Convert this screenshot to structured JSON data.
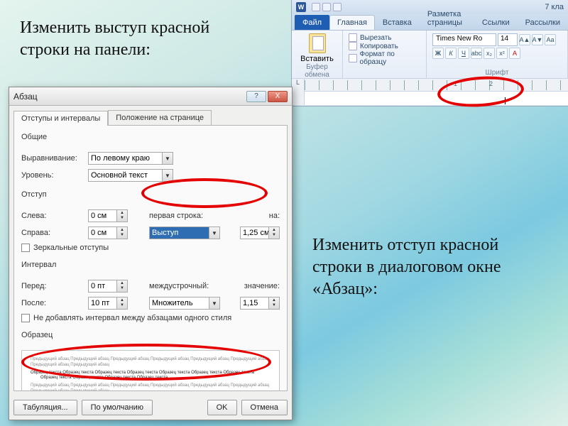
{
  "captions": {
    "top": "Изменить выступ красной строки на панели:",
    "bottom": "Изменить отступ красной строки в диалоговом окне «Абзац»:"
  },
  "word": {
    "app_label": "W",
    "title_text": "7 кла",
    "tabs": {
      "file": "Файл",
      "home": "Главная",
      "insert": "Вставка",
      "layout": "Разметка страницы",
      "refs": "Ссылки",
      "mail": "Рассылки"
    },
    "clipboard": {
      "paste": "Вставить",
      "cut": "Вырезать",
      "copy": "Копировать",
      "format_painter": "Формат по образцу",
      "group_label": "Буфер обмена"
    },
    "font": {
      "name": "Times New Ro",
      "size": "14",
      "group_label": "Шрифт"
    },
    "ruler": {
      "corner": "L",
      "n1": "1",
      "n2": "2"
    }
  },
  "dialog": {
    "title": "Абзац",
    "help": "?",
    "close": "X",
    "tabs": {
      "indents": "Отступы и интервалы",
      "position": "Положение на странице"
    },
    "general": {
      "label": "Общие",
      "alignment_label": "Выравнивание:",
      "alignment_value": "По левому краю",
      "level_label": "Уровень:",
      "level_value": "Основной текст"
    },
    "indent": {
      "label": "Отступ",
      "left_label": "Слева:",
      "left_value": "0 см",
      "right_label": "Справа:",
      "right_value": "0 см",
      "firstline_label": "первая строка:",
      "firstline_value": "Выступ",
      "by_label": "на:",
      "by_value": "1,25 см",
      "mirror": "Зеркальные отступы"
    },
    "spacing": {
      "label": "Интервал",
      "before_label": "Перед:",
      "before_value": "0 пт",
      "after_label": "После:",
      "after_value": "10 пт",
      "line_label": "междустрочный:",
      "line_value": "Множитель",
      "at_label": "значение:",
      "at_value": "1,15",
      "no_space": "Не добавлять интервал между абзацами одного стиля"
    },
    "preview": {
      "label": "Образец",
      "filler": "Предыдущий абзац Предыдущий абзац Предыдущий абзац Предыдущий абзац Предыдущий абзац Предыдущий абзац Предыдущий абзац Предыдущий абзац",
      "main": "Образец текста Образец текста Образец текста Образец текста Образец текста Образец текста Образец текста Образец текста Образец текста Образец текста Образец текста"
    },
    "buttons": {
      "tabs": "Табуляция...",
      "default": "По умолчанию",
      "ok": "OK",
      "cancel": "Отмена"
    }
  }
}
